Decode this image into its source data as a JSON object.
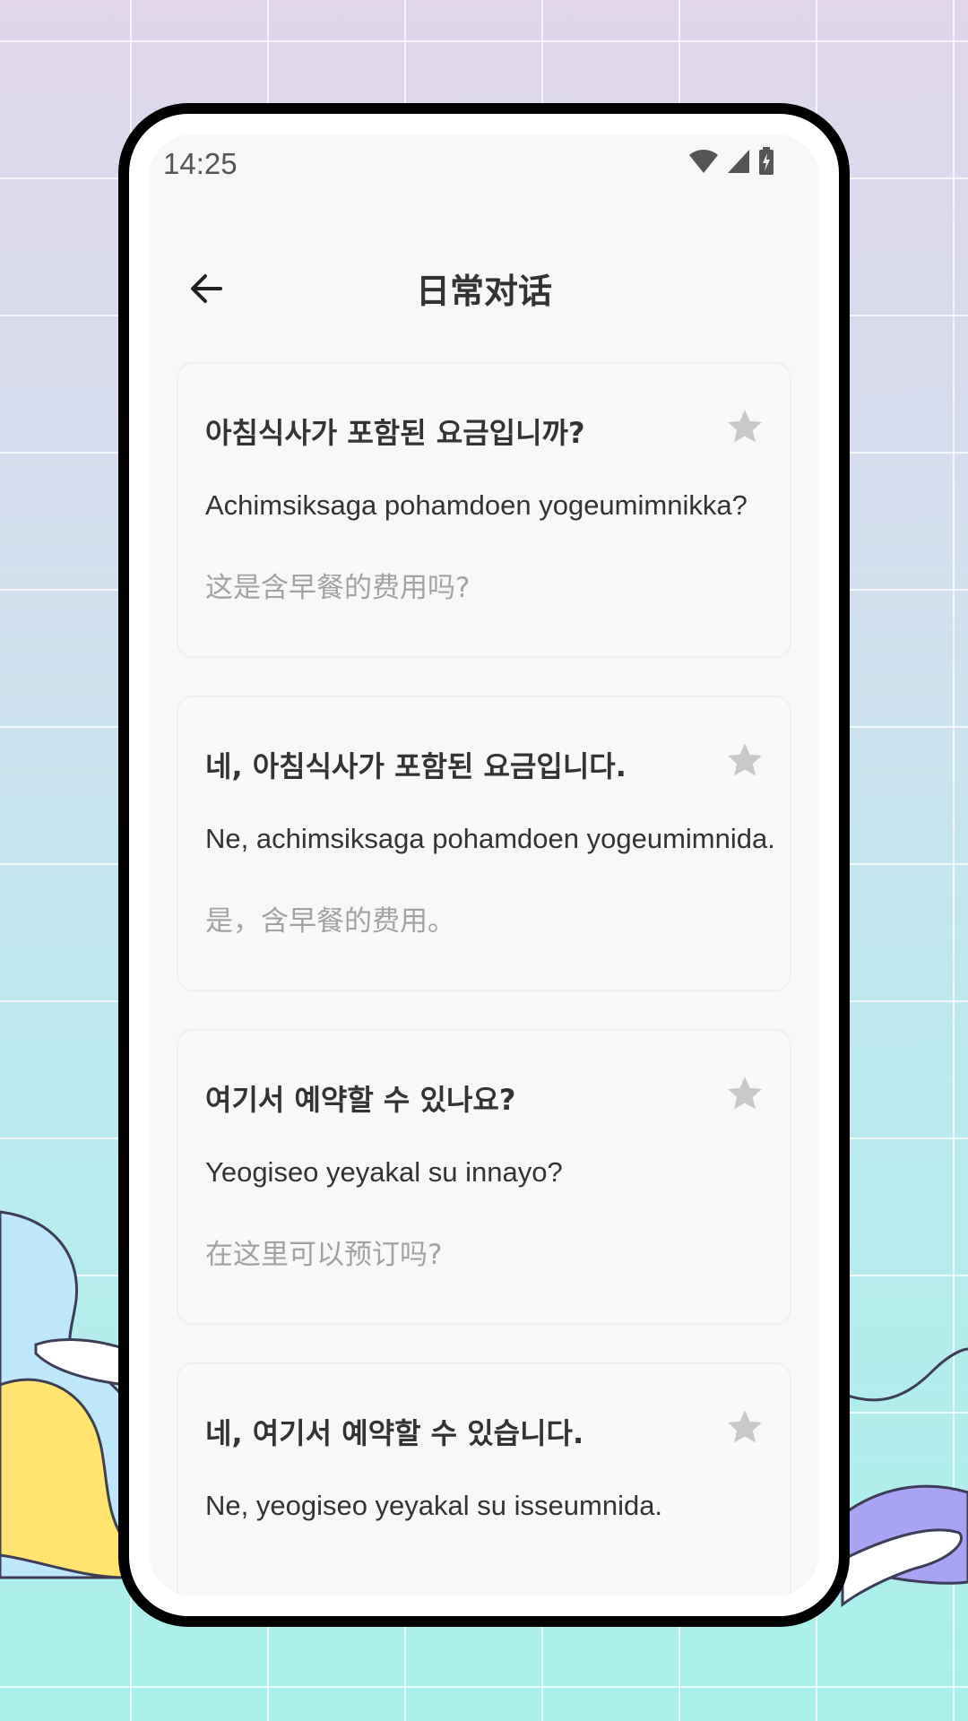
{
  "status_bar": {
    "time": "14:25",
    "icons": [
      "wifi-icon",
      "signal-icon",
      "battery-charging-icon"
    ]
  },
  "app_bar": {
    "back_icon": "arrow-left-icon",
    "title": "日常对话"
  },
  "colors": {
    "star_inactive": "#c8c8c8",
    "card_bg": "#f8f8f8",
    "korean_text": "#333333",
    "chinese_text": "#a2a2a2"
  },
  "phrases": [
    {
      "korean": "아침식사가 포함된 요금입니까?",
      "romanization": "Achimsiksaga pohamdoen yogeumimnikka?",
      "chinese": "这是含早餐的费用吗?",
      "favorite": false
    },
    {
      "korean": "네, 아침식사가 포함된 요금입니다.",
      "romanization": "Ne, achimsiksaga pohamdoen yogeumimnida.",
      "chinese": "是，含早餐的费用。",
      "favorite": false
    },
    {
      "korean": "여기서 예약할 수 있나요?",
      "romanization": "Yeogiseo yeyakal su innayo?",
      "chinese": "在这里可以预订吗?",
      "favorite": false
    },
    {
      "korean": "네, 여기서 예약할 수 있습니다.",
      "romanization": "Ne, yeogiseo yeyakal su isseumnida.",
      "chinese": "",
      "favorite": false
    }
  ]
}
